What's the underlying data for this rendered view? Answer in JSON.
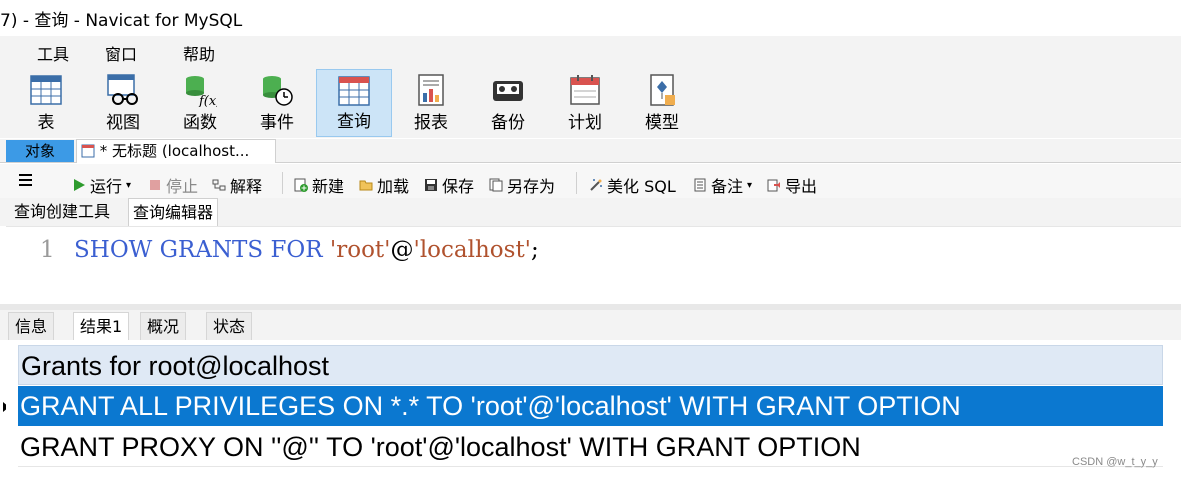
{
  "window": {
    "title": "7) - 查询 - Navicat for MySQL"
  },
  "menu": [
    "工具",
    "窗口",
    "帮助"
  ],
  "ribbon": [
    {
      "label": "表",
      "icon": "table-icon"
    },
    {
      "label": "视图",
      "icon": "view-icon"
    },
    {
      "label": "函数",
      "icon": "function-icon"
    },
    {
      "label": "事件",
      "icon": "event-icon"
    },
    {
      "label": "查询",
      "icon": "query-icon",
      "active": true
    },
    {
      "label": "报表",
      "icon": "report-icon"
    },
    {
      "label": "备份",
      "icon": "backup-icon"
    },
    {
      "label": "计划",
      "icon": "schedule-icon"
    },
    {
      "label": "模型",
      "icon": "model-icon"
    }
  ],
  "tabs": {
    "objects": "对象",
    "query_doc": "* 无标题 (localhost..."
  },
  "toolbar": {
    "run": "运行",
    "stop": "停止",
    "explain": "解释",
    "new": "新建",
    "load": "加载",
    "save": "保存",
    "save_as": "另存为",
    "beautify": "美化 SQL",
    "comment": "备注",
    "export": "导出"
  },
  "editor_tabs": [
    "查询创建工具",
    "查询编辑器"
  ],
  "editor": {
    "line_number": "1",
    "tokens": {
      "kw1": "SHOW",
      "kw2": "GRANTS",
      "kw3": "FOR",
      "str1": "'root'",
      "at": "@",
      "str2": "'localhost'",
      "semi": ";"
    }
  },
  "result_tabs": [
    "信息",
    "结果1",
    "概况",
    "状态"
  ],
  "result": {
    "column": "Grants for root@localhost",
    "rows": [
      "GRANT ALL PRIVILEGES ON *.* TO 'root'@'localhost' WITH GRANT OPTION",
      "GRANT PROXY ON ''@'' TO 'root'@'localhost' WITH GRANT OPTION"
    ]
  },
  "watermark": "CSDN @w_t_y_y",
  "colors": {
    "accent": "#0b78d0",
    "tab_active": "#3c9ae6",
    "keyword": "#3b5fd1",
    "string": "#b0522e"
  }
}
